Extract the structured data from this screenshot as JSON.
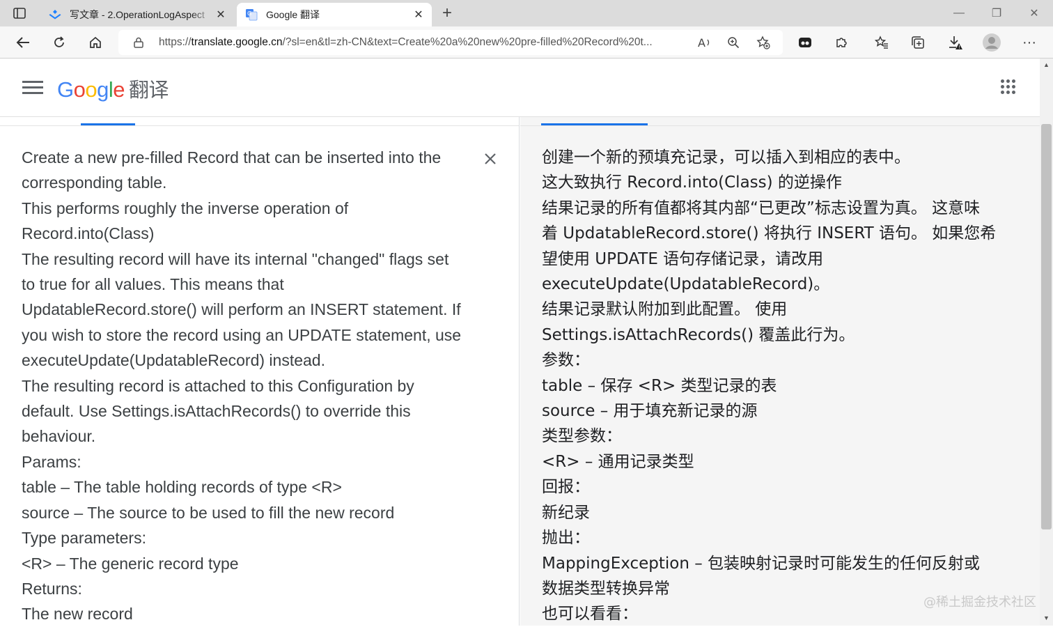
{
  "browser": {
    "tabs": [
      {
        "title": "写文章 - 2.OperationLogAspect",
        "favicon": "juejin-icon"
      },
      {
        "title": "Google 翻译",
        "favicon": "google-translate-icon"
      }
    ],
    "url_prefix": "https://",
    "url_host": "translate.google.cn",
    "url_rest": "/?sl=en&tl=zh-CN&text=Create%20a%20new%20pre-filled%20Record%20t..."
  },
  "header": {
    "logo_word": "Google",
    "logo_suffix": "翻译",
    "logo_colors": [
      "#4285F4",
      "#EA4335",
      "#FBBC05",
      "#4285F4",
      "#34A853",
      "#EA4335"
    ]
  },
  "source": {
    "lines": [
      "Create a new pre-filled Record that can be inserted into the",
      "corresponding table.",
      "This performs roughly the inverse operation of",
      "Record.into(Class)",
      "The resulting record will have its internal \"changed\" flags set",
      "to true for all values. This means that",
      "UpdatableRecord.store() will perform an INSERT statement. If",
      "you wish to store the record using an UPDATE statement, use",
      "executeUpdate(UpdatableRecord) instead.",
      "The resulting record is attached to this Configuration by",
      "default. Use Settings.isAttachRecords() to override this",
      "behaviour.",
      "Params:",
      "table – The table holding records of type <R>",
      "source – The source to be used to fill the new record",
      "Type parameters:",
      "<R> – The generic record type",
      "Returns:",
      "The new record"
    ]
  },
  "target": {
    "lines": [
      "创建一个新的预填充记录，可以插入到相应的表中。",
      "这大致执行 Record.into(Class) 的逆操作",
      "结果记录的所有值都将其内部“已更改”标志设置为真。 这意味",
      "着 UpdatableRecord.store() 将执行 INSERT 语句。 如果您希",
      "望使用 UPDATE 语句存储记录，请改用",
      "executeUpdate(UpdatableRecord)。",
      "结果记录默认附加到此配置。 使用",
      "Settings.isAttachRecords() 覆盖此行为。",
      "参数：",
      "table – 保存 <R> 类型记录的表",
      "source – 用于填充新记录的源",
      "类型参数：",
      "<R> – 通用记录类型",
      "回报：",
      "新纪录",
      "抛出：",
      "MappingException – 包装映射记录时可能发生的任何反射或",
      "数据类型转换异常",
      "也可以看看："
    ]
  },
  "watermark": "@稀土掘金技术社区"
}
